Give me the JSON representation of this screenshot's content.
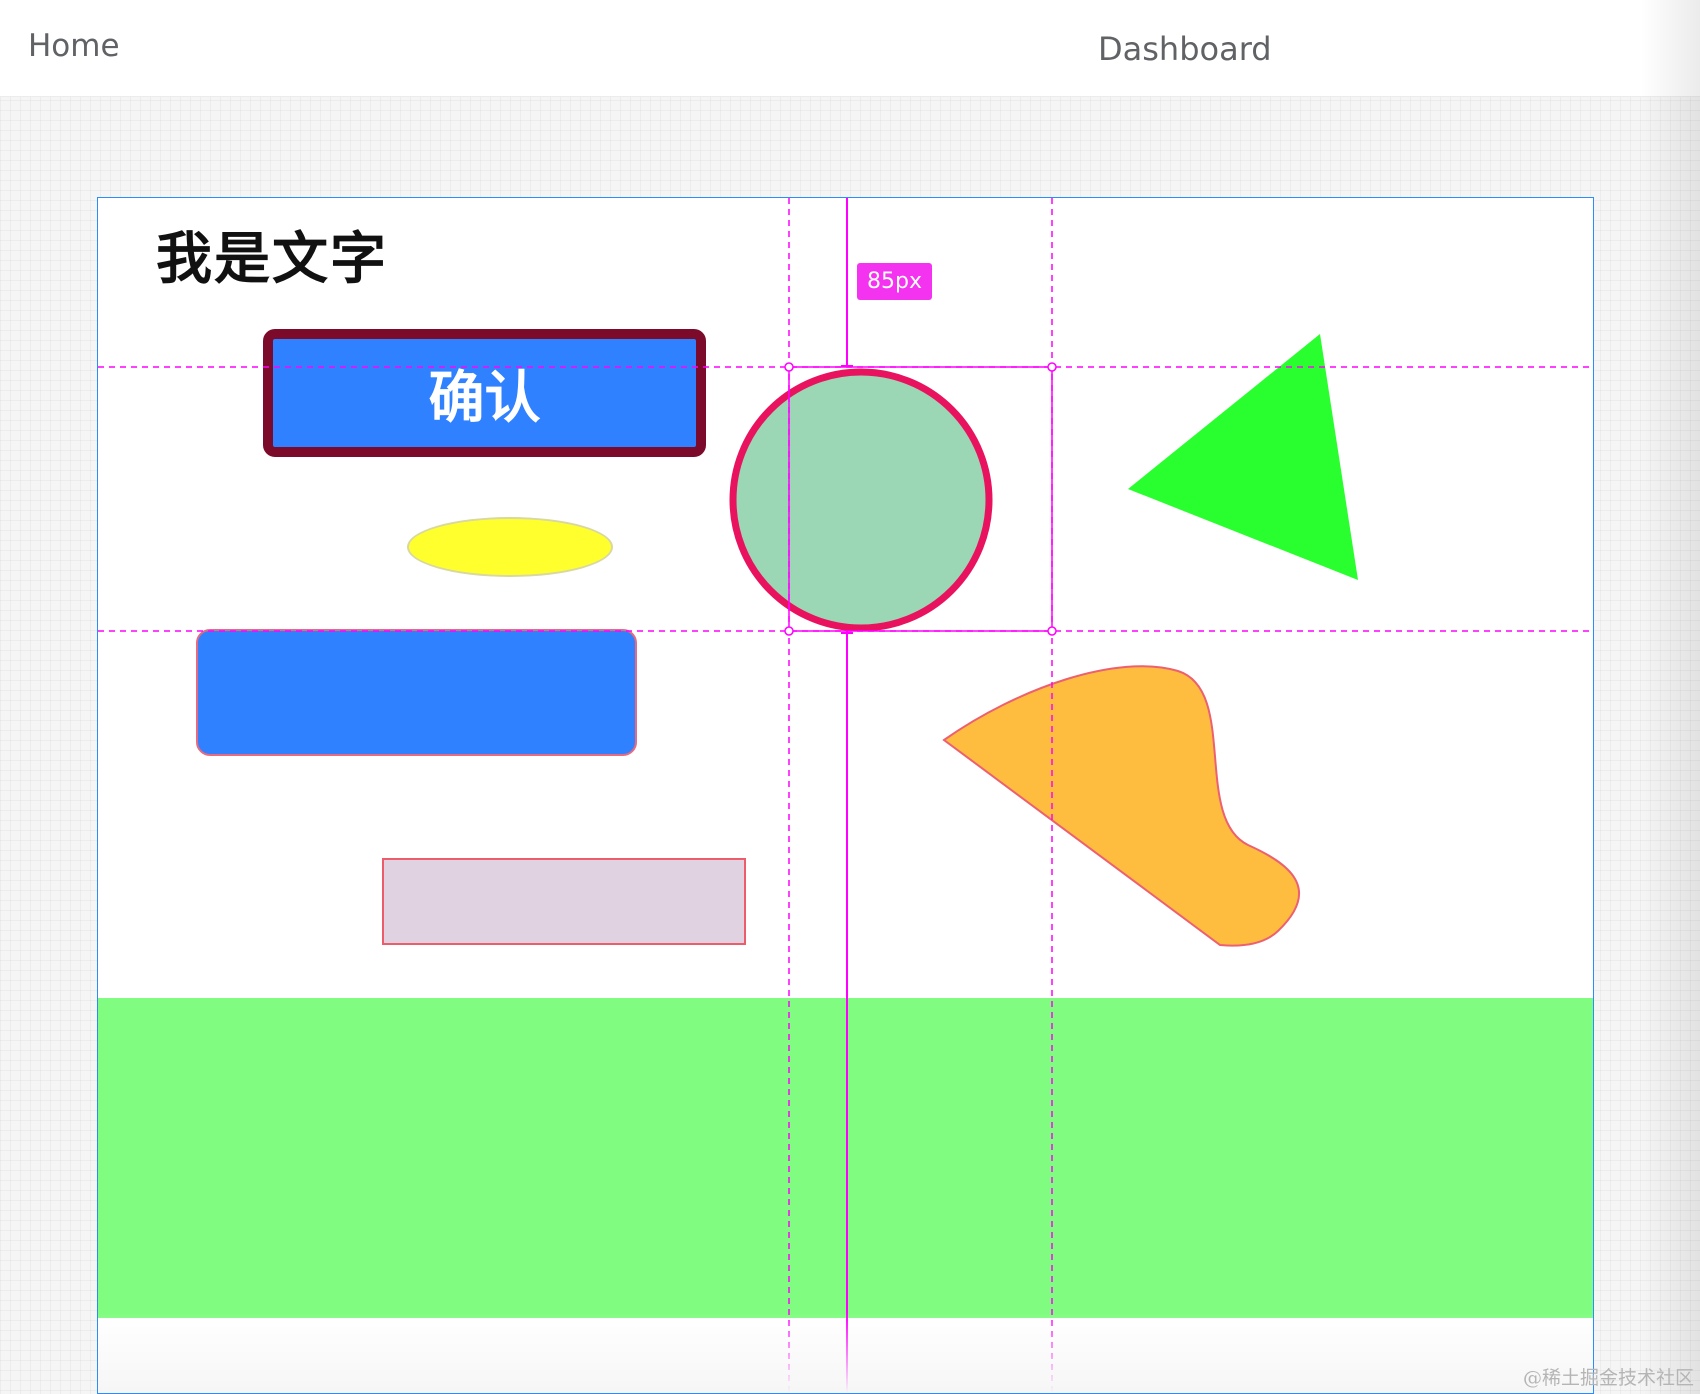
{
  "nav": {
    "home_label": "Home",
    "dashboard_label": "Dashboard"
  },
  "canvas": {
    "text_element": "我是文字",
    "confirm_button_label": "确认",
    "measure_label": "85px"
  },
  "colors": {
    "selection_border": "#2b8cff",
    "guide_color": "#ff00ff",
    "button_fill": "#2f81ff",
    "button_border": "#7b0a2b",
    "circle_fill": "#9bd6b5",
    "circle_stroke": "#e8125e",
    "triangle_fill": "#29ff2e",
    "blob_fill": "#ffbd40",
    "band_fill": "#80fd80",
    "ellipse_fill": "#ffff2e",
    "pink_rect_fill": "#e0d2e0"
  },
  "watermark": "@稀土掘金技术社区"
}
